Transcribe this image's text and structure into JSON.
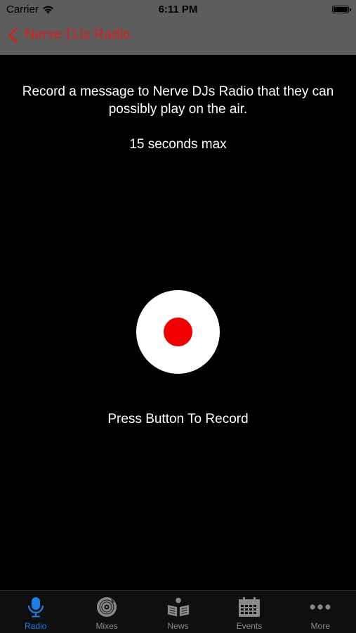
{
  "status_bar": {
    "carrier": "Carrier",
    "time": "6:11 PM"
  },
  "nav": {
    "back_label": "Nerve DJs Radio"
  },
  "main": {
    "intro": "Record a message to Nerve DJs Radio that they can possibly play on the air.",
    "max_duration": "15 seconds max",
    "instruction": "Press Button To Record"
  },
  "tabs": [
    {
      "label": "Radio",
      "icon": "microphone-icon",
      "active": true
    },
    {
      "label": "Mixes",
      "icon": "vinyl-record-icon",
      "active": false
    },
    {
      "label": "News",
      "icon": "newspaper-icon",
      "active": false
    },
    {
      "label": "Events",
      "icon": "calendar-icon",
      "active": false
    },
    {
      "label": "More",
      "icon": "more-dots-icon",
      "active": false
    }
  ],
  "colors": {
    "accent_red": "#d8201f",
    "record_red": "#f10000",
    "active_tab_blue": "#1a7fe6",
    "inactive_tab_gray": "#8a8a8a"
  }
}
